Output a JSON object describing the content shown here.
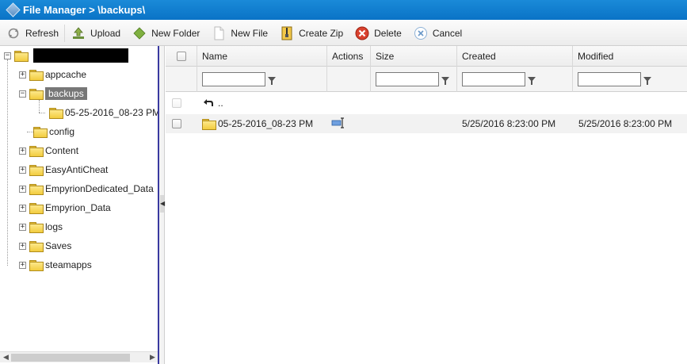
{
  "window": {
    "title": "File Manager > \\backups\\"
  },
  "toolbar": {
    "refresh": "Refresh",
    "upload": "Upload",
    "new_folder": "New Folder",
    "new_file": "New File",
    "create_zip": "Create Zip",
    "delete": "Delete",
    "cancel": "Cancel"
  },
  "tree": {
    "root_label": "",
    "items": [
      {
        "label": "appcache"
      },
      {
        "label": "backups"
      },
      {
        "label": "05-25-2016_08-23 PM"
      },
      {
        "label": "config"
      },
      {
        "label": "Content"
      },
      {
        "label": "EasyAntiCheat"
      },
      {
        "label": "EmpyrionDedicated_Data"
      },
      {
        "label": "Empyrion_Data"
      },
      {
        "label": "logs"
      },
      {
        "label": "Saves"
      },
      {
        "label": "steamapps"
      }
    ]
  },
  "grid": {
    "columns": {
      "name": "Name",
      "actions": "Actions",
      "size": "Size",
      "created": "Created",
      "modified": "Modified"
    },
    "filters": {
      "name": "",
      "size": "",
      "created": "",
      "modified": ""
    },
    "up_row": {
      "name": ".."
    },
    "rows": [
      {
        "name": "05-25-2016_08-23 PM",
        "size": "",
        "created": "5/25/2016 8:23:00 PM",
        "modified": "5/25/2016 8:23:00 PM"
      }
    ]
  },
  "colors": {
    "titlebar": "#0a73c6",
    "selection": "#777777",
    "tree_border": "#3a3aa0"
  }
}
